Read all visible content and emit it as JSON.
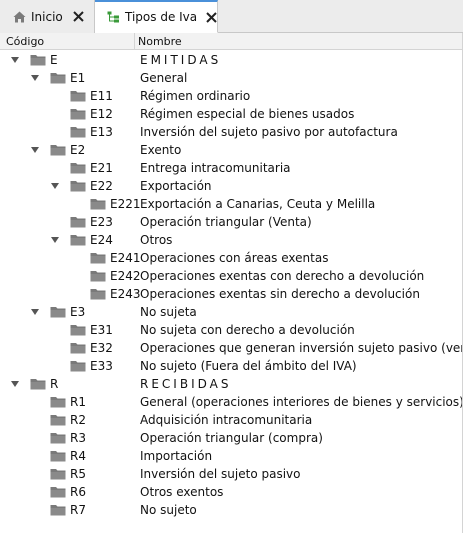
{
  "tabs": [
    {
      "label": "Inicio",
      "icon": "home-icon"
    },
    {
      "label": "Tipos de Iva",
      "icon": "tree-icon"
    }
  ],
  "columns": {
    "code": "Código",
    "name": "Nombre"
  },
  "rows": [
    {
      "code": "E",
      "name": "EMITIDAS",
      "level": 0,
      "expanded": true
    },
    {
      "code": "E1",
      "name": "General",
      "level": 1,
      "expanded": true
    },
    {
      "code": "E11",
      "name": "Régimen ordinario",
      "level": 2
    },
    {
      "code": "E12",
      "name": "Régimen especial de bienes usados",
      "level": 2
    },
    {
      "code": "E13",
      "name": "Inversión del sujeto pasivo por autofactura",
      "level": 2
    },
    {
      "code": "E2",
      "name": "Exento",
      "level": 1,
      "expanded": true
    },
    {
      "code": "E21",
      "name": "Entrega intracomunitaria",
      "level": 2
    },
    {
      "code": "E22",
      "name": "Exportación",
      "level": 2,
      "expanded": true
    },
    {
      "code": "E221",
      "name": "Exportación a Canarias, Ceuta y Melilla",
      "level": 3
    },
    {
      "code": "E23",
      "name": "Operación triangular (Venta)",
      "level": 2
    },
    {
      "code": "E24",
      "name": "Otros",
      "level": 2,
      "expanded": true
    },
    {
      "code": "E241",
      "name": "Operaciones con áreas exentas",
      "level": 3
    },
    {
      "code": "E242",
      "name": "Operaciones exentas con derecho a devolución",
      "level": 3
    },
    {
      "code": "E243",
      "name": "Operaciones exentas sin derecho a devolución",
      "level": 3
    },
    {
      "code": "E3",
      "name": "No sujeta",
      "level": 1,
      "expanded": true
    },
    {
      "code": "E31",
      "name": "No sujeta con derecho a devolución",
      "level": 2
    },
    {
      "code": "E32",
      "name": "Operaciones que generan inversión sujeto pasivo (venta)",
      "level": 2
    },
    {
      "code": "E33",
      "name": "No sujeto (Fuera del ámbito del IVA)",
      "level": 2
    },
    {
      "code": "R",
      "name": "RECIBIDAS",
      "level": 0,
      "expanded": true
    },
    {
      "code": "R1",
      "name": "General (operaciones interiores de bienes y servicios)",
      "level": 1
    },
    {
      "code": "R2",
      "name": "Adquisición intracomunitaria",
      "level": 1
    },
    {
      "code": "R3",
      "name": "Operación triangular (compra)",
      "level": 1
    },
    {
      "code": "R4",
      "name": "Importación",
      "level": 1
    },
    {
      "code": "R5",
      "name": "Inversión del sujeto pasivo",
      "level": 1
    },
    {
      "code": "R6",
      "name": "Otros exentos",
      "level": 1
    },
    {
      "code": "R7",
      "name": "No sujeto",
      "level": 1
    }
  ]
}
